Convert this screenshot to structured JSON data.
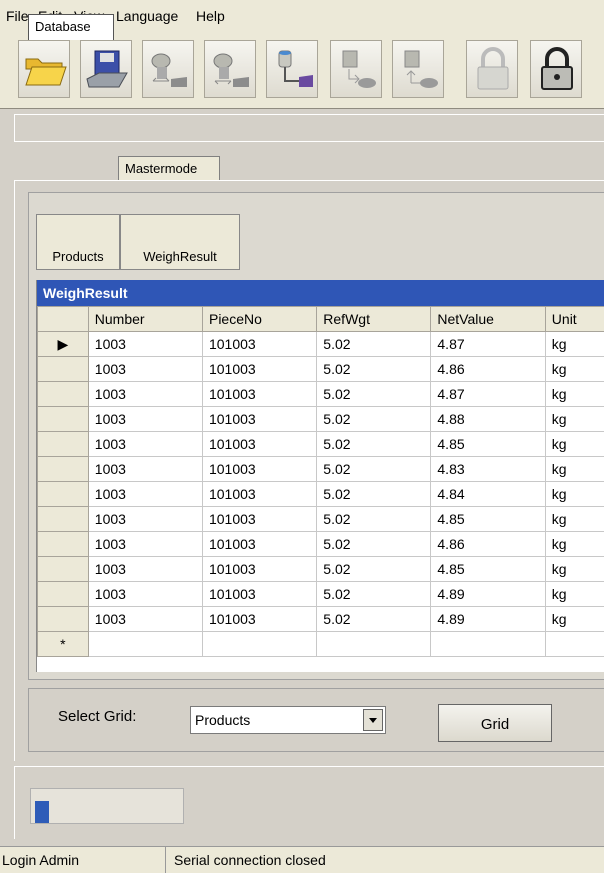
{
  "menu": {
    "items": [
      "File",
      "Edit",
      "View",
      "Language",
      "Help"
    ]
  },
  "toolbar": {
    "buttons": [
      {
        "icon": "open-folder-icon"
      },
      {
        "icon": "save-disk-icon"
      },
      {
        "icon": "scale-transfer-icon"
      },
      {
        "icon": "scale-transfer-icon"
      },
      {
        "icon": "scale-database-icon"
      },
      {
        "icon": "upload-icon"
      },
      {
        "icon": "download-icon"
      },
      {
        "icon": "lock-open-icon"
      },
      {
        "icon": "lock-icon"
      }
    ]
  },
  "tabs": [
    "Database",
    "Mastermode"
  ],
  "subtabs": [
    "Products",
    "WeighResult"
  ],
  "grid": {
    "caption": "WeighResult",
    "columns": [
      "Number",
      "PieceNo",
      "RefWgt",
      "NetValue",
      "Unit"
    ],
    "rows": [
      [
        "1003",
        "101003",
        "5.02",
        "4.87",
        "kg"
      ],
      [
        "1003",
        "101003",
        "5.02",
        "4.86",
        "kg"
      ],
      [
        "1003",
        "101003",
        "5.02",
        "4.87",
        "kg"
      ],
      [
        "1003",
        "101003",
        "5.02",
        "4.88",
        "kg"
      ],
      [
        "1003",
        "101003",
        "5.02",
        "4.85",
        "kg"
      ],
      [
        "1003",
        "101003",
        "5.02",
        "4.83",
        "kg"
      ],
      [
        "1003",
        "101003",
        "5.02",
        "4.84",
        "kg"
      ],
      [
        "1003",
        "101003",
        "5.02",
        "4.85",
        "kg"
      ],
      [
        "1003",
        "101003",
        "5.02",
        "4.86",
        "kg"
      ],
      [
        "1003",
        "101003",
        "5.02",
        "4.85",
        "kg"
      ],
      [
        "1003",
        "101003",
        "5.02",
        "4.89",
        "kg"
      ],
      [
        "1003",
        "101003",
        "5.02",
        "4.89",
        "kg"
      ]
    ],
    "current_row_marker": "▶",
    "new_row_marker": "*"
  },
  "select": {
    "label": "Select Grid:",
    "value": "Products",
    "button": "Grid"
  },
  "progress": {
    "fraction": 0.1
  },
  "status": {
    "user": "Login Admin",
    "connection": "Serial connection closed"
  },
  "colors": {
    "caption": "#2f56b6",
    "progress": "#2e5cb8"
  }
}
